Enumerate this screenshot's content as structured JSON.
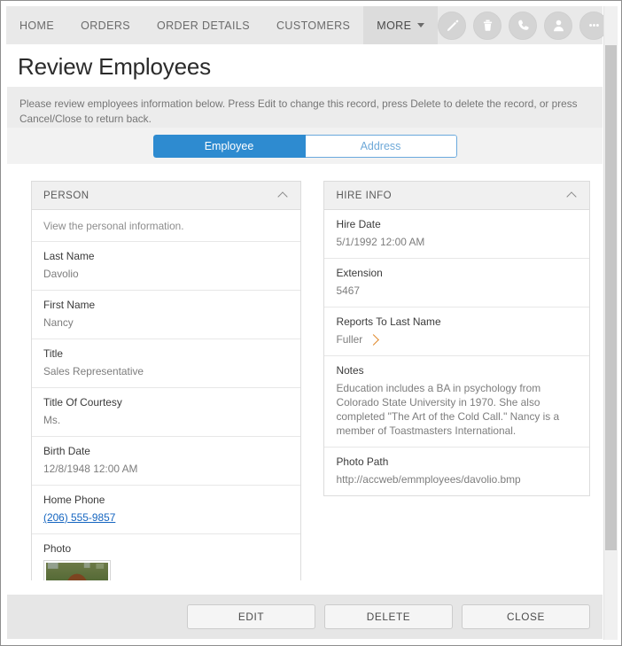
{
  "navbar": {
    "links": [
      {
        "label": "HOME",
        "active": false
      },
      {
        "label": "ORDERS",
        "active": false
      },
      {
        "label": "ORDER DETAILS",
        "active": false
      },
      {
        "label": "CUSTOMERS",
        "active": false
      },
      {
        "label": "MORE",
        "active": true,
        "has_caret": true
      }
    ],
    "actions": [
      {
        "icon": "pencil-icon",
        "name": "edit-action-button"
      },
      {
        "icon": "trash-icon",
        "name": "delete-action-button"
      },
      {
        "icon": "phone-icon",
        "name": "phone-action-button"
      },
      {
        "icon": "person-icon",
        "name": "person-action-button"
      },
      {
        "icon": "ellipsis-icon",
        "name": "more-action-button"
      }
    ]
  },
  "page": {
    "title": "Review Employees",
    "description": "Please review employees information below. Press Edit to change this record, press Delete to delete the record, or press Cancel/Close to return back."
  },
  "tabs": [
    {
      "label": "Employee",
      "active": true
    },
    {
      "label": "Address",
      "active": false
    }
  ],
  "panels": {
    "person": {
      "header": "PERSON",
      "collapse_icon": "chevron-up-icon",
      "note": "View the personal information.",
      "fields": [
        {
          "label": "Last Name",
          "value": "Davolio",
          "type": "text"
        },
        {
          "label": "First Name",
          "value": "Nancy",
          "type": "text"
        },
        {
          "label": "Title",
          "value": "Sales Representative",
          "type": "text"
        },
        {
          "label": "Title Of Courtesy",
          "value": "Ms.",
          "type": "text"
        },
        {
          "label": "Birth Date",
          "value": "12/8/1948 12:00 AM",
          "type": "text"
        },
        {
          "label": "Home Phone",
          "value": "(206) 555-9857",
          "type": "link"
        },
        {
          "label": "Photo",
          "value": "",
          "type": "photo"
        }
      ]
    },
    "hire_info": {
      "header": "HIRE INFO",
      "collapse_icon": "chevron-up-icon",
      "fields": [
        {
          "label": "Hire Date",
          "value": "5/1/1992 12:00 AM",
          "type": "text"
        },
        {
          "label": "Extension",
          "value": "5467",
          "type": "text"
        },
        {
          "label": "Reports To Last Name",
          "value": "Fuller",
          "type": "lookup"
        },
        {
          "label": "Notes",
          "value": "Education includes a BA in psychology from Colorado State University in 1970. She also completed \"The Art of the Cold Call.\" Nancy is a member of Toastmasters International.",
          "type": "text"
        },
        {
          "label": "Photo Path",
          "value": "http://accweb/emmployees/davolio.bmp",
          "type": "text"
        }
      ]
    }
  },
  "footer": {
    "buttons": [
      {
        "label": "EDIT",
        "name": "edit-button"
      },
      {
        "label": "DELETE",
        "name": "delete-button"
      },
      {
        "label": "CLOSE",
        "name": "close-button"
      }
    ]
  },
  "colors": {
    "accent_blue": "#2e8bd0",
    "link_blue": "#1565c0",
    "lookup_arrow": "#e08a2e",
    "nav_bg": "#e9e9e9",
    "footer_bg": "#e6e6e6"
  }
}
